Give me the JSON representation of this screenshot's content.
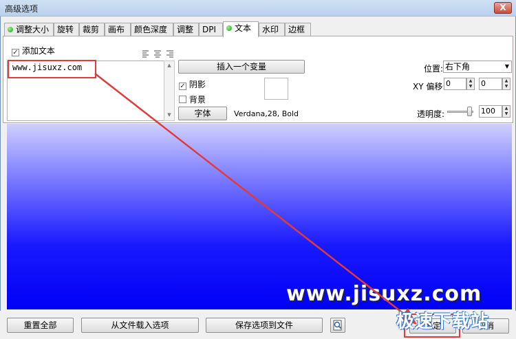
{
  "window": {
    "title": "高级选项",
    "close_label": "X"
  },
  "tabs": [
    {
      "label": "调整大小",
      "dot": true
    },
    {
      "label": "旋转"
    },
    {
      "label": "裁剪"
    },
    {
      "label": "画布"
    },
    {
      "label": "颜色深度"
    },
    {
      "label": "调整"
    },
    {
      "label": "DPI"
    },
    {
      "label": "文本",
      "dot": true,
      "active": true
    },
    {
      "label": "水印"
    },
    {
      "label": "边框"
    }
  ],
  "text_tab": {
    "add_text_label": "添加文本",
    "add_text_checked": true,
    "text_value": "www.jisuxz.com",
    "insert_variable_label": "插入一个变量",
    "shadow_label": "阴影",
    "shadow_checked": true,
    "background_label": "背景",
    "background_checked": false,
    "font_button_label": "字体",
    "font_info": "Verdana,28, Bold",
    "position_label": "位置:",
    "position_value": "右下角",
    "xy_offset_label": "XY 偏移:",
    "x_offset": "0",
    "y_offset": "0",
    "opacity_label": "透明度:",
    "opacity_value": "100"
  },
  "preview": {
    "text": "www.jisuxz.com"
  },
  "footer": {
    "reset_all_label": "重置全部",
    "load_from_file_label": "从文件载入选项",
    "save_to_file_label": "保存选项到文件",
    "ok_label": "确定",
    "cancel_label": "取消"
  },
  "watermark_text": "极速下载站",
  "colors": {
    "annotation_red": "#e03a3a",
    "preview_blue": "#0000f5",
    "tab_dot_green": "#1aa11a"
  }
}
